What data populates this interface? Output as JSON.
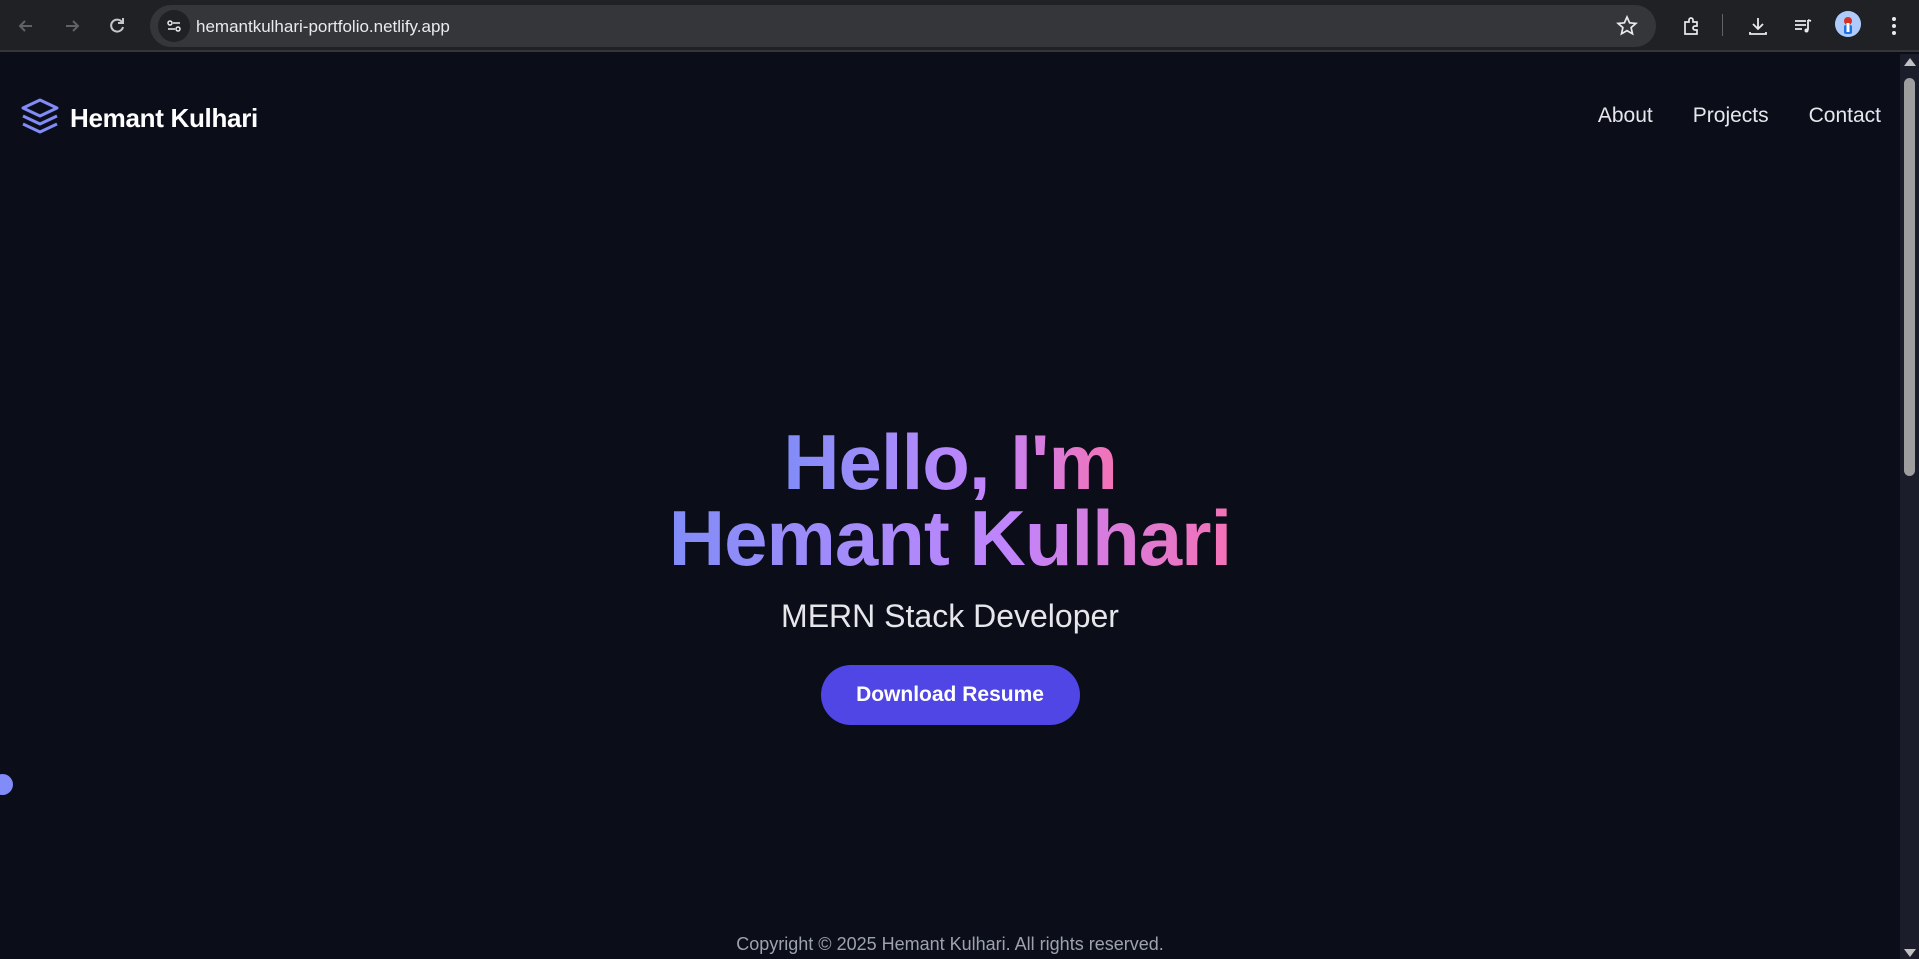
{
  "browser": {
    "url": "hemantkulhari-portfolio.netlify.app",
    "icons": {
      "back": "back-arrow-icon",
      "forward": "forward-arrow-icon",
      "reload": "reload-icon",
      "site_info": "site-settings-icon",
      "bookmark": "star-icon",
      "extensions": "puzzle-icon",
      "downloads": "download-icon",
      "media": "media-queue-icon",
      "profile": "avatar",
      "menu": "kebab-menu-icon"
    }
  },
  "header": {
    "brand_name": "Hemant Kulhari",
    "brand_icon": "stacked-layers-icon",
    "nav": [
      {
        "label": "About"
      },
      {
        "label": "Projects"
      },
      {
        "label": "Contact"
      }
    ]
  },
  "hero": {
    "greeting": "Hello, I'm",
    "name": "Hemant Kulhari",
    "role": "MERN Stack Developer",
    "cta_label": "Download Resume"
  },
  "footer": {
    "copyright": "Copyright © 2025 Hemant Kulhari. All rights reserved."
  },
  "colors": {
    "background": "#0b0d19",
    "accent": "#4f46e5",
    "gradient_start": "#818cf8",
    "gradient_mid": "#c084fc",
    "gradient_end": "#f472b6"
  }
}
